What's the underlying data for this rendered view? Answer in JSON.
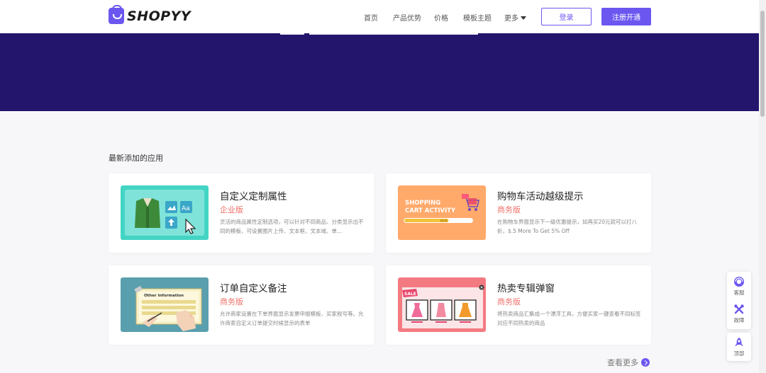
{
  "brand": {
    "name": "SHOPYY",
    "color": "#6b57f0"
  },
  "nav": {
    "items": [
      "首页",
      "产品优势",
      "价格",
      "模板主题",
      "更多"
    ],
    "login_label": "登录",
    "register_label": "注册开通"
  },
  "section": {
    "title": "最新添加的应用"
  },
  "apps": [
    {
      "title": "自定义定制属性",
      "tag": "企业版",
      "desc": "灵活的商品属性定制选项，可以针对不同商品、分类显示出不同的模板，可设置图片上传、文本框、文本域、单...",
      "thumb_text": "Aa"
    },
    {
      "title": "购物车活动越级提示",
      "tag": "商务版",
      "desc": "在购物车界面显示下一级优惠提示，如再买20元就可以打八折，$.5 More To Get 5% Off",
      "thumb_text": "SHOPPING CART ACTIVITY",
      "progress": 0.65,
      "progress_label": "65%"
    },
    {
      "title": "订单自定义备注",
      "tag": "商务版",
      "desc": "允许商家设置在下单界面显示发票申报模板、买家税号等。允许商家自定义订单提交时候显示的表单",
      "thumb_text": "Other Information"
    },
    {
      "title": "热卖专辑弹窗",
      "tag": "商务版",
      "desc": "将热卖商品汇集成一个漂浮工具，方便买家一键查看不同标签对应不同热卖的商品",
      "thumb_text": "SALE"
    }
  ],
  "more_link": "查看更多",
  "float_buttons": {
    "service": "客服",
    "fault": "故障",
    "top": "顶部"
  },
  "colors": {
    "hero": "#22156b",
    "accent": "#6b57f0",
    "tag": "#f0716b"
  }
}
